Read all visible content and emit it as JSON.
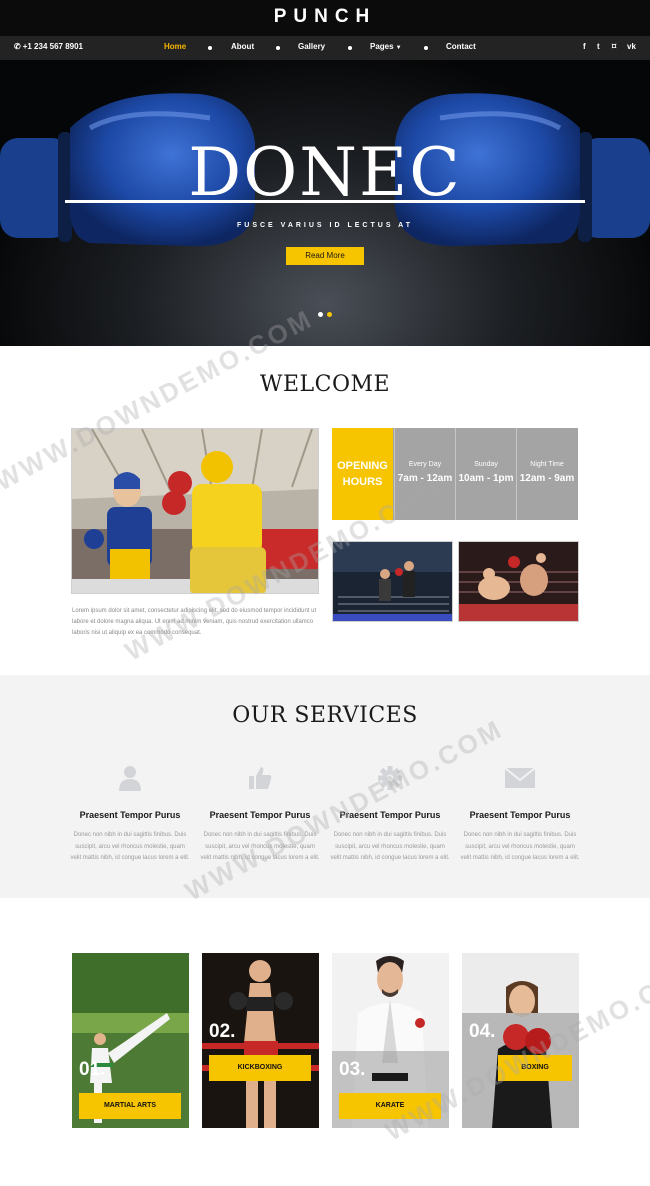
{
  "header": {
    "logo": "PUNCH",
    "phone": "+1 234 567 8901",
    "nav": [
      {
        "label": "Home",
        "active": true
      },
      {
        "label": "About"
      },
      {
        "label": "Gallery"
      },
      {
        "label": "Pages"
      },
      {
        "label": "Contact"
      }
    ],
    "social_icons": [
      "facebook-icon",
      "twitter-icon",
      "rss-icon",
      "vk-icon"
    ],
    "social_glyphs": [
      "f",
      "t",
      "⌑",
      "vk"
    ]
  },
  "hero": {
    "title": "DONEC",
    "subtitle": "FUSCE VARIUS ID LECTUS AT",
    "button": "Read More",
    "slides": 2,
    "active_slide": 2
  },
  "welcome": {
    "title": "WELCOME",
    "text": "Lorem ipsum dolor sit amet, consectetur adipiscing elit, sed do eiusmod tempor incididunt ut labore et dolore magna aliqua. Ut enim ad minim veniam, quis nostrud exercitation ullamco laboris nisi ut aliquip ex ea commodo consequat.",
    "opening_hours": {
      "heading": "OPENING HOURS",
      "columns": [
        {
          "day": "Every Day",
          "time": "7am - 12am"
        },
        {
          "day": "Sunday",
          "time": "10am - 1pm"
        },
        {
          "day": "Night Time",
          "time": "12am - 9am"
        }
      ]
    }
  },
  "services": {
    "title": "OUR SERVICES",
    "items": [
      {
        "icon": "user-icon",
        "title": "Praesent Tempor Purus",
        "text": "Donec non nibh in dui sagittis finibus. Duis suscipit, arcu vel rhoncus molestie, quam velit mattis nibh, id congue lacus lorem a elit."
      },
      {
        "icon": "thumbs-up-icon",
        "title": "Praesent Tempor Purus",
        "text": "Donec non nibh in dui sagittis finibus. Duis suscipit, arcu vel rhoncus molestie, quam velit mattis nibh, id congue lacus lorem a elit."
      },
      {
        "icon": "gear-icon",
        "title": "Praesent Tempor Purus",
        "text": "Donec non nibh in dui sagittis finibus. Duis suscipit, arcu vel rhoncus molestie, quam velit mattis nibh, id congue lacus lorem a elit."
      },
      {
        "icon": "envelope-icon",
        "title": "Praesent Tempor Purus",
        "text": "Donec non nibh in dui sagittis finibus. Duis suscipit, arcu vel rhoncus molestie, quam velit mattis nibh, id congue lacus lorem a elit."
      }
    ]
  },
  "classes": [
    {
      "number": "01.",
      "label": "MARTIAL ARTS"
    },
    {
      "number": "02.",
      "label": "KICKBOXING"
    },
    {
      "number": "03.",
      "label": "KARATE"
    },
    {
      "number": "04.",
      "label": "BOXING"
    }
  ],
  "watermark": "WWW.DOWNDEMO.COM",
  "colors": {
    "accent": "#f7c400",
    "nav_active": "#f7b500",
    "dark": "#0b0b0b",
    "glove": "#1f4fb0"
  }
}
